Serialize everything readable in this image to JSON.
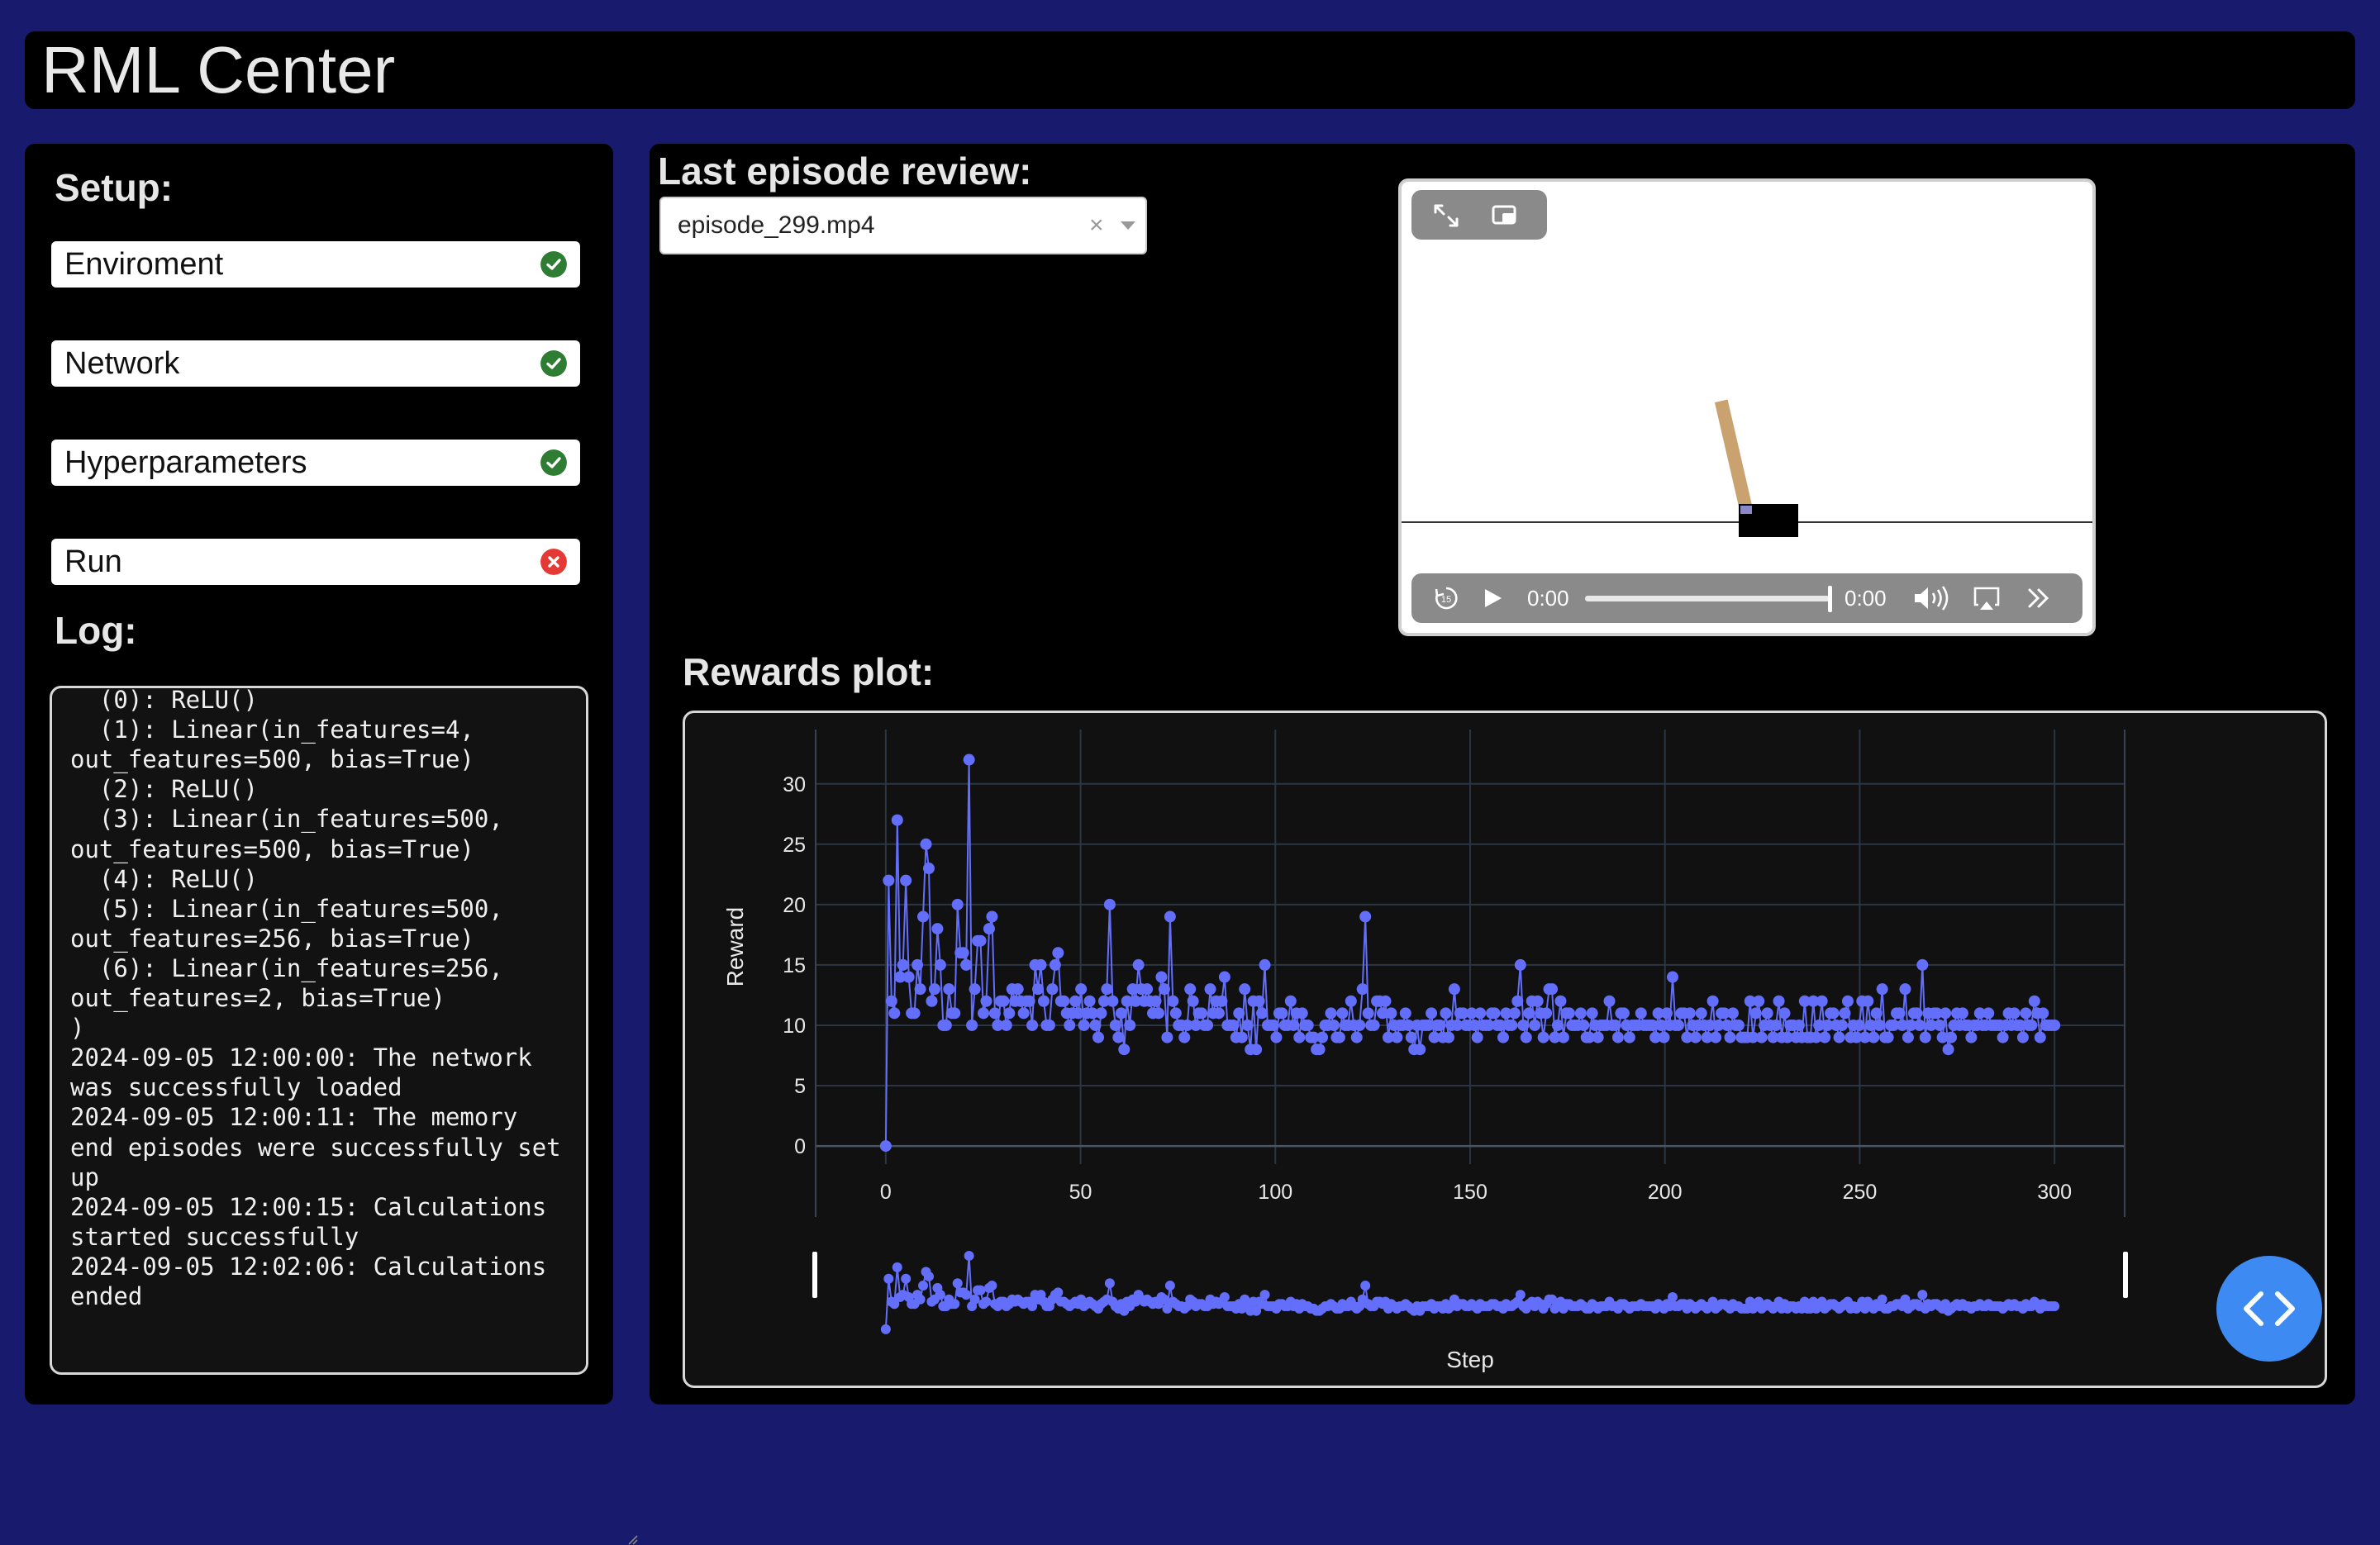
{
  "app_title": "RML Center",
  "setup": {
    "title": "Setup:",
    "items": [
      {
        "label": "Enviroment",
        "status": "ok",
        "status_icon": "check-circle-icon",
        "color": "#2e7d32"
      },
      {
        "label": "Network",
        "status": "ok",
        "status_icon": "check-circle-icon",
        "color": "#2e7d32"
      },
      {
        "label": "Hyperparameters",
        "status": "ok",
        "status_icon": "check-circle-icon",
        "color": "#2e7d32"
      },
      {
        "label": "Run",
        "status": "error",
        "status_icon": "x-circle-icon",
        "color": "#e53935"
      }
    ]
  },
  "log": {
    "title": "Log:",
    "text": "Sequential(\n  (0): ReLU()\n  (1): Linear(in_features=4, out_features=500, bias=True)\n  (2): ReLU()\n  (3): Linear(in_features=500, out_features=500, bias=True)\n  (4): ReLU()\n  (5): Linear(in_features=500, out_features=256, bias=True)\n  (6): Linear(in_features=256, out_features=2, bias=True)\n)\n2024-09-05 12:00:00: The network was successfully loaded\n2024-09-05 12:00:11: The memory end episodes were successfully set up\n2024-09-05 12:00:15: Calculations started successfully\n2024-09-05 12:02:06: Calculations ended"
  },
  "episode": {
    "title": "Last episode review:",
    "selected": "episode_299.mp4",
    "clear_symbol": "×"
  },
  "video": {
    "current_time": "0:00",
    "duration": "0:00",
    "progress": 1.0
  },
  "rewards": {
    "title": "Rewards plot:"
  },
  "chart_data": {
    "type": "scatter",
    "mode": "lines+markers",
    "xlabel": "Step",
    "ylabel": "Reward",
    "xlim": [
      -18,
      318
    ],
    "ylim": [
      -1.5,
      34.5
    ],
    "x_ticks": [
      0,
      50,
      100,
      150,
      200,
      250,
      300
    ],
    "y_ticks": [
      0,
      5,
      10,
      15,
      20,
      25,
      30
    ],
    "grid": true,
    "color": "#636efa",
    "range_slider": true,
    "x_start": 0,
    "values": [
      0,
      22,
      12,
      11,
      27,
      14,
      15,
      22,
      14,
      11,
      11,
      15,
      13,
      19,
      25,
      23,
      12,
      13,
      18,
      15,
      10,
      10,
      13,
      11,
      11,
      20,
      16,
      16,
      15,
      32,
      10,
      13,
      17,
      17,
      11,
      12,
      18,
      19,
      11,
      10,
      12,
      12,
      10,
      11,
      13,
      12,
      13,
      12,
      11,
      12,
      12,
      10,
      15,
      13,
      15,
      12,
      10,
      10,
      13,
      15,
      16,
      12,
      12,
      11,
      10,
      11,
      12,
      11,
      13,
      10,
      11,
      12,
      11,
      10,
      9,
      11,
      12,
      13,
      20,
      12,
      10,
      9,
      11,
      8,
      12,
      10,
      13,
      12,
      15,
      13,
      12,
      13,
      12,
      11,
      12,
      11,
      14,
      13,
      9,
      19,
      12,
      11,
      10,
      10,
      9,
      10,
      13,
      12,
      10,
      11,
      11,
      10,
      10,
      13,
      11,
      12,
      11,
      12,
      14,
      10,
      10,
      10,
      9,
      11,
      9,
      13,
      10,
      8,
      12,
      8,
      12,
      11,
      15,
      10,
      10,
      10,
      9,
      11,
      11,
      10,
      10,
      12,
      10,
      11,
      9,
      11,
      10,
      10,
      9,
      9,
      8,
      8,
      9,
      10,
      10,
      11,
      10,
      9,
      9,
      11,
      10,
      10,
      12,
      10,
      9,
      10,
      13,
      19,
      11,
      10,
      10,
      12,
      12,
      11,
      12,
      9,
      11,
      10,
      9,
      10,
      10,
      11,
      10,
      9,
      8,
      10,
      8,
      10,
      10,
      10,
      11,
      9,
      10,
      10,
      9,
      11,
      9,
      10,
      13,
      10,
      11,
      11,
      10,
      10,
      11,
      10,
      9,
      11,
      10,
      10,
      10,
      11,
      11,
      10,
      10,
      9,
      11,
      10,
      10,
      11,
      12,
      15,
      10,
      9,
      11,
      12,
      10,
      12,
      11,
      9,
      11,
      13,
      13,
      9,
      10,
      12,
      9,
      11,
      11,
      10,
      10,
      10,
      11,
      10,
      9,
      9,
      11,
      10,
      9,
      10,
      10,
      10,
      12,
      10,
      10,
      9,
      11,
      11,
      10,
      9,
      10,
      10,
      10,
      11,
      10,
      10,
      10,
      10,
      9,
      11,
      10,
      9,
      11,
      10,
      14,
      10,
      10,
      11,
      11,
      9,
      11,
      10,
      9,
      10,
      11,
      10,
      9,
      10,
      12,
      9,
      10,
      11,
      11,
      10,
      9,
      11,
      10,
      10,
      9,
      9,
      9,
      12,
      9,
      11,
      12,
      9,
      10,
      11,
      10,
      9,
      10,
      12,
      9,
      11,
      9,
      10,
      10,
      9,
      10,
      9,
      12,
      9,
      9,
      12,
      9,
      10,
      12,
      9,
      10,
      11,
      11,
      10,
      9,
      10,
      11,
      12,
      9,
      10,
      9,
      10,
      12,
      9,
      12,
      10,
      9,
      11,
      10,
      13,
      9,
      9,
      10,
      10,
      11,
      11,
      10,
      13,
      9,
      10,
      11,
      11,
      10,
      15,
      9,
      11,
      10,
      11,
      11,
      10,
      9,
      11,
      8,
      9,
      10,
      11,
      10,
      11,
      10,
      10,
      9,
      10,
      10,
      11,
      10,
      10,
      11,
      10,
      10,
      10,
      10,
      9,
      10,
      11,
      10,
      11,
      10,
      10,
      9,
      11,
      10,
      10,
      12,
      11,
      9,
      11,
      10,
      10,
      10,
      10
    ]
  }
}
